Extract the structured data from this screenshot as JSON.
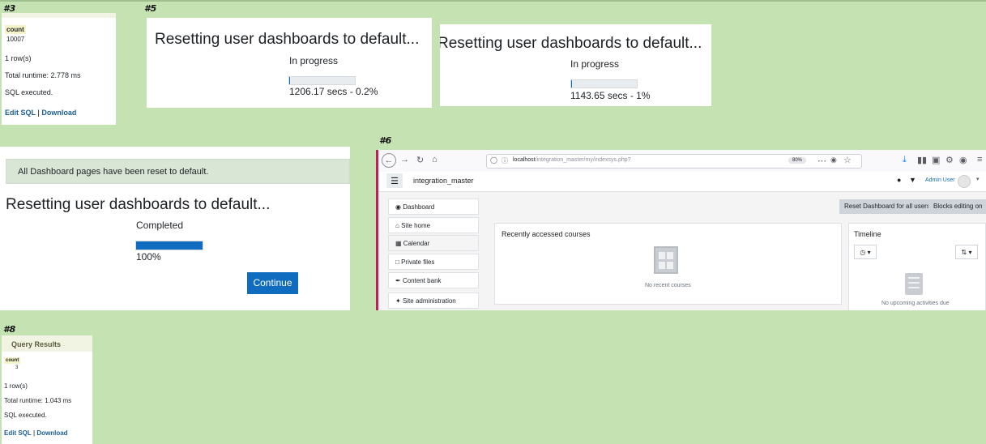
{
  "markers": {
    "m3": "#3",
    "m5": "#5",
    "m6": "#6",
    "m8": "#8"
  },
  "panel3": {
    "col_header": "count",
    "col_value": "10007",
    "rows": "1 row(s)",
    "runtime": "Total runtime: 2.778 ms",
    "executed": "SQL executed.",
    "edit_sql": "Edit SQL",
    "separator": "|",
    "download": "Download"
  },
  "progress_a": {
    "title": "Resetting user dashboards to default...",
    "status": "In progress",
    "progress_fraction": 0.002,
    "detail": "1206.17 secs - 0.2%"
  },
  "progress_b": {
    "title": "Resetting user dashboards to default...",
    "status": "In progress",
    "progress_fraction": 0.01,
    "detail": "1143.65 secs - 1%"
  },
  "completed": {
    "alert": "All Dashboard pages have been reset to default.",
    "title": "Resetting user dashboards to default...",
    "status": "Completed",
    "progress_fraction": 1.0,
    "percent": "100%",
    "continue": "Continue"
  },
  "browser": {
    "url_host": "localhost",
    "url_path": "/integration_master/my/indexsys.php?",
    "zoom": "80%",
    "site_name": "integration_master",
    "user_name": "Admin User",
    "nav": [
      "Dashboard",
      "Site home",
      "Calendar",
      "Private files",
      "Content bank",
      "Site administration"
    ],
    "nav_icons": [
      "dashboard-icon",
      "home-icon",
      "calendar-icon",
      "file-icon",
      "brush-icon",
      "wrench-icon"
    ],
    "reset_button": "Reset Dashboard for all users",
    "blocks_button": "Blocks editing on",
    "recent_title": "Recently accessed courses",
    "recent_empty": "No recent courses",
    "timeline_title": "Timeline",
    "timeline_empty": "No upcoming activities due"
  },
  "panel8": {
    "title": "Query Results",
    "col_header": "count",
    "col_value": "3",
    "rows": "1 row(s)",
    "runtime": "Total runtime: 1.043 ms",
    "executed": "SQL executed.",
    "edit_sql": "Edit SQL",
    "separator": "|",
    "download": "Download"
  },
  "colors": {
    "background": "#c5e2b3",
    "primary": "#0f6cbf",
    "alert_bg": "#d9e6d5",
    "moodle_accent": "#c41c53"
  }
}
